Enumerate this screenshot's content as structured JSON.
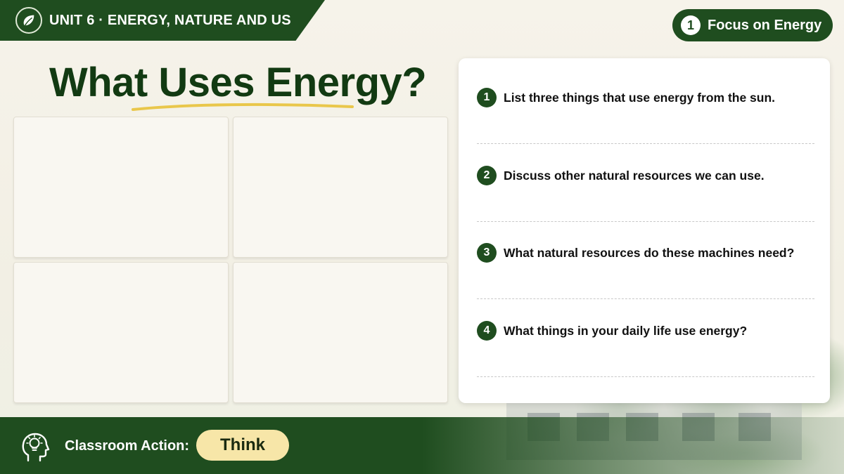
{
  "header": {
    "unit_label": "UNIT 6 · ENERGY, NATURE AND US",
    "unit_icon": "leaf-icon",
    "focus_number": "1",
    "focus_label": "Focus on Energy"
  },
  "main": {
    "title": "What Uses Energy?",
    "image_placeholders": 4
  },
  "questions": [
    {
      "number": "1",
      "text": "List three things that use energy from the sun."
    },
    {
      "number": "2",
      "text": "Discuss other natural resources we can use."
    },
    {
      "number": "3",
      "text": "What natural resources do these machines need?"
    },
    {
      "number": "4",
      "text": "What things in your daily life use energy?"
    }
  ],
  "footer": {
    "action_icon": "head-lightbulb-icon",
    "action_label": "Classroom Action:",
    "action_value": "Think"
  },
  "colors": {
    "primary_green": "#1f4d1f",
    "title_green": "#123a12",
    "highlight_yellow": "#f7e6a8",
    "underline_gold": "#e8c23a"
  }
}
